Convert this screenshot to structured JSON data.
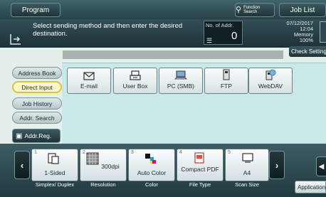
{
  "header": {
    "program_label": "Program",
    "function_search_label": "Function Search",
    "job_list_label": "Job List"
  },
  "message": {
    "text": "Select sending method and then enter the desired destination.",
    "no_of_addr_label": "No. of Addr.",
    "no_of_addr_value": "0",
    "date": "07/12/2017",
    "time": "12:04",
    "memory_label": "Memory",
    "memory_value": "100%",
    "check_settings_label": "Check Setting"
  },
  "left_tabs": [
    {
      "label": "Address Book",
      "active": false
    },
    {
      "label": "Direct Input",
      "active": true
    },
    {
      "label": "Job History",
      "active": false
    },
    {
      "label": "Addr. Search",
      "active": false
    }
  ],
  "addr_reg_label": "Addr.Reg.",
  "destinations": [
    {
      "label": "E-mail",
      "icon": "envelope-icon"
    },
    {
      "label": "User Box",
      "icon": "user-box-icon"
    },
    {
      "label": "PC (SMB)",
      "icon": "pc-icon"
    },
    {
      "label": "FTP",
      "icon": "ftp-server-icon"
    },
    {
      "label": "WebDAV",
      "icon": "webdav-icon"
    }
  ],
  "settings": [
    {
      "num": "1",
      "value": "1-Sided",
      "label": "Simplex/ Duplex",
      "icon": "simplex-icon"
    },
    {
      "num": "2",
      "value": "300dpi",
      "label": "Resolution",
      "icon": "resolution-icon"
    },
    {
      "num": "3",
      "value": "Auto Color",
      "label": "Color",
      "icon": "color-icon"
    },
    {
      "num": "4",
      "value": "Compact PDF",
      "label": "File Type",
      "icon": "pdf-icon"
    },
    {
      "num": "5",
      "value": "A4",
      "label": "Scan Size",
      "icon": "scan-size-icon"
    }
  ],
  "application_label": "Application",
  "colors": {
    "active_tab_border": "#d9c53a",
    "panel_bg": "#c9e9e9",
    "header_bg": "#274247"
  }
}
